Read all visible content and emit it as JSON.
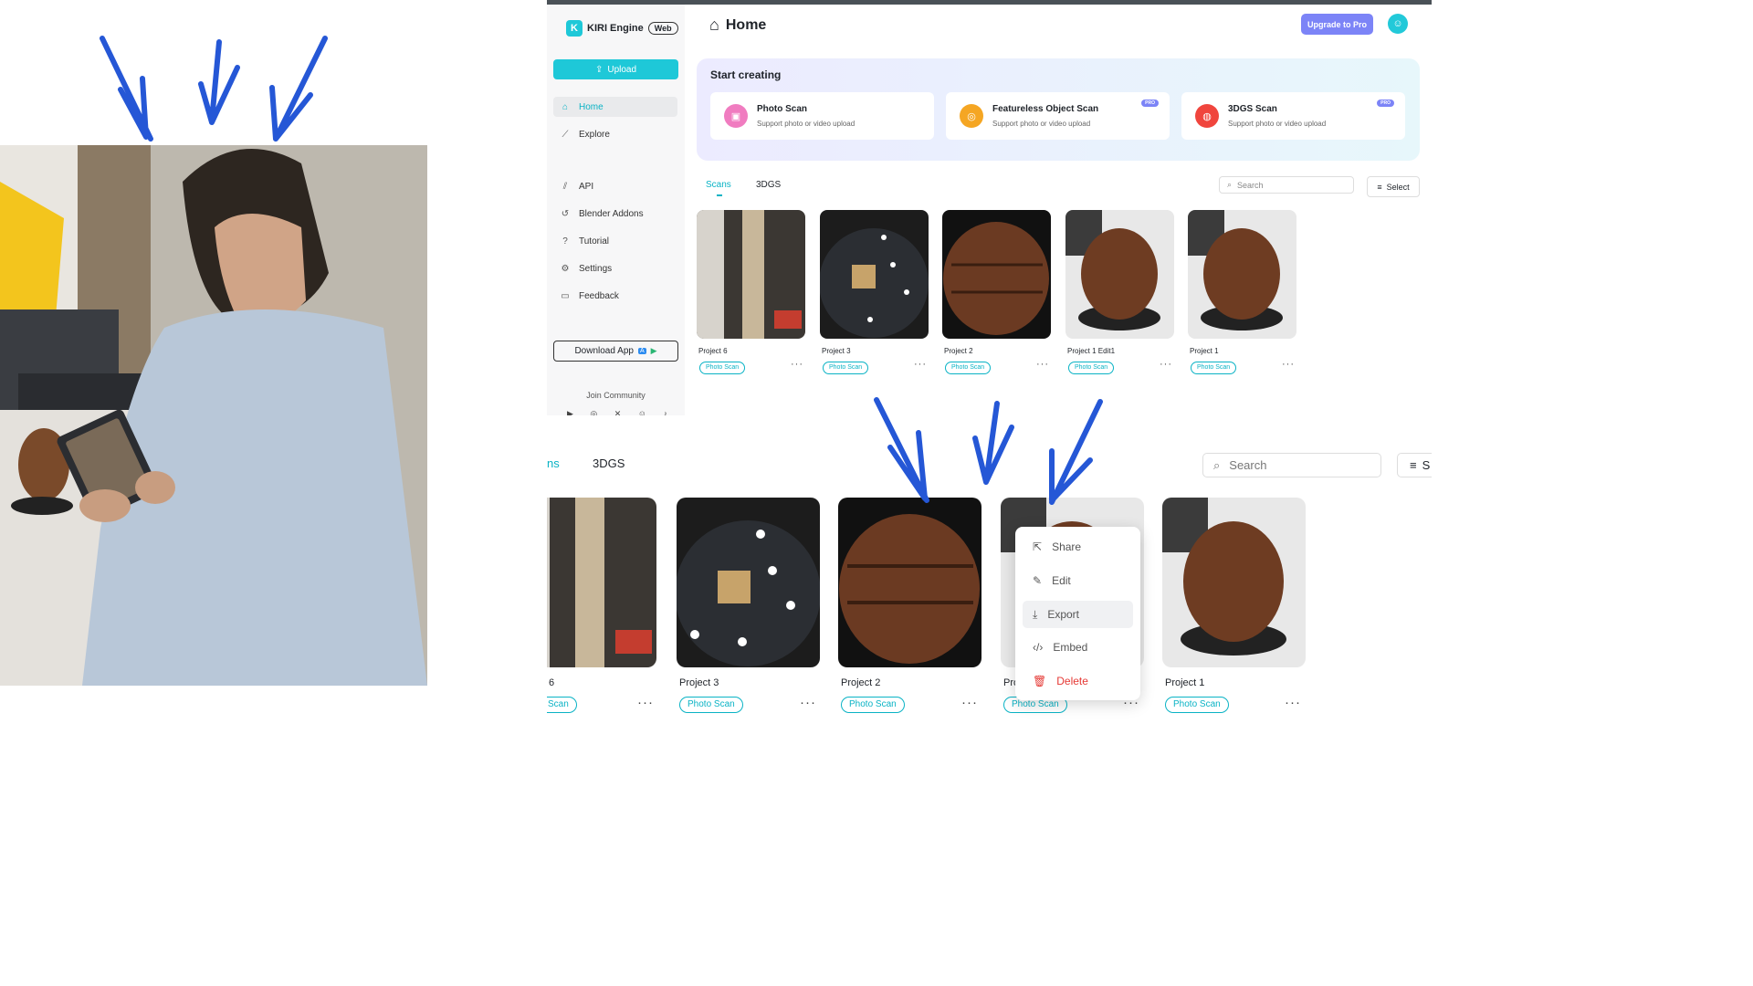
{
  "app": {
    "brand": "KIRI Engine",
    "brand_tag": "Web",
    "upload_label": "Upload",
    "nav": [
      {
        "label": "Home",
        "icon": "home-icon"
      },
      {
        "label": "Explore",
        "icon": "compass-icon"
      },
      {
        "label": "API",
        "icon": "api-icon"
      },
      {
        "label": "Blender Addons",
        "icon": "blender-icon"
      },
      {
        "label": "Tutorial",
        "icon": "help-icon"
      },
      {
        "label": "Settings",
        "icon": "gear-icon"
      },
      {
        "label": "Feedback",
        "icon": "feedback-icon"
      }
    ],
    "download_label": "Download App",
    "community_label": "Join Community",
    "page_title": "Home",
    "upgrade_label": "Upgrade to Pro",
    "start_title": "Start creating",
    "scan_types": [
      {
        "title": "Photo Scan",
        "subtitle": "Support photo or video upload",
        "pro": ""
      },
      {
        "title": "Featureless Object Scan",
        "subtitle": "Support photo or video upload",
        "pro": "PRO"
      },
      {
        "title": "3DGS Scan",
        "subtitle": "Support photo or video upload",
        "pro": "PRO"
      }
    ],
    "tabs": [
      "Scans",
      "3DGS"
    ],
    "search_placeholder": "Search",
    "select_label": "Select",
    "projects": [
      {
        "name": "Project 6",
        "tag": "Photo Scan"
      },
      {
        "name": "Project 3",
        "tag": "Photo Scan"
      },
      {
        "name": "Project 2",
        "tag": "Photo Scan"
      },
      {
        "name": "Project 1 Edit1",
        "tag": "Photo Scan"
      },
      {
        "name": "Project 1",
        "tag": "Photo Scan"
      }
    ]
  },
  "zoomed": {
    "tab_partial": "ns",
    "tab_3dgs": "3DGS",
    "search_placeholder": "Search",
    "select_partial": "S",
    "projects": [
      {
        "name": "6",
        "tag": "Scan"
      },
      {
        "name": "Project 3",
        "tag": "Photo Scan"
      },
      {
        "name": "Project 2",
        "tag": "Photo Scan"
      },
      {
        "name": "Pro",
        "tag": "Photo Scan"
      },
      {
        "name": "Project 1",
        "tag": "Photo Scan"
      }
    ],
    "menu": [
      "Share",
      "Edit",
      "Export",
      "Embed",
      "Delete"
    ]
  },
  "colors": {
    "accent": "#1ec8d8",
    "pro": "#7c84f7",
    "arrow": "#2557d6",
    "delete": "#e53935"
  }
}
